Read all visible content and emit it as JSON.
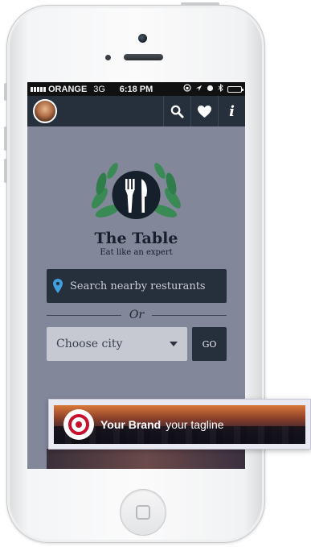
{
  "status_bar": {
    "carrier": "ORANGE",
    "network": "3G",
    "time": "6:18 PM"
  },
  "navbar": {
    "icons": [
      "avatar",
      "search-icon",
      "heart-icon",
      "info-icon"
    ],
    "info_label": "i"
  },
  "app": {
    "title": "The Table",
    "tagline": "Eat like an expert",
    "search_label": "Search nearby resturants",
    "or_label": "Or",
    "city_placeholder": "Choose city",
    "go_label": "GO"
  },
  "banner": {
    "brand": "Your Brand",
    "tagline": "your tagline"
  },
  "colors": {
    "navbar": "#26303d",
    "accent_green": "#3a8a55",
    "pin_blue": "#3fa0e0",
    "logo_red": "#c8102e"
  }
}
